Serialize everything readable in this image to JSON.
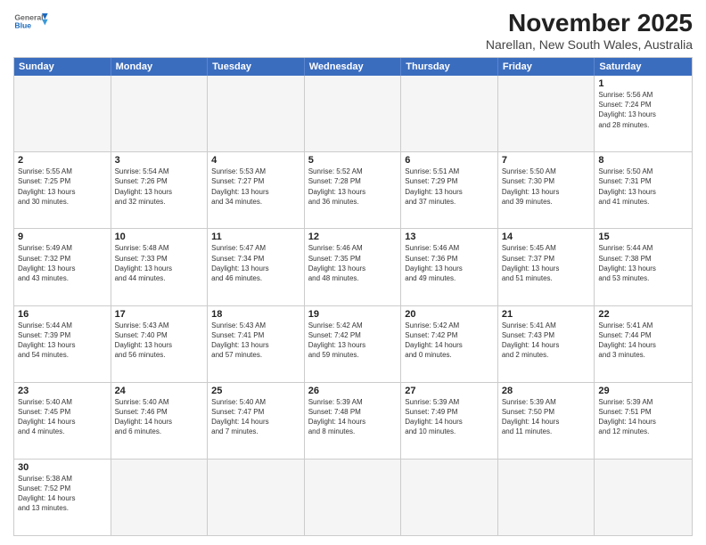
{
  "header": {
    "logo_general": "General",
    "logo_blue": "Blue",
    "month_title": "November 2025",
    "location": "Narellan, New South Wales, Australia"
  },
  "day_headers": [
    "Sunday",
    "Monday",
    "Tuesday",
    "Wednesday",
    "Thursday",
    "Friday",
    "Saturday"
  ],
  "weeks": [
    [
      {
        "num": "",
        "info": ""
      },
      {
        "num": "",
        "info": ""
      },
      {
        "num": "",
        "info": ""
      },
      {
        "num": "",
        "info": ""
      },
      {
        "num": "",
        "info": ""
      },
      {
        "num": "",
        "info": ""
      },
      {
        "num": "1",
        "info": "Sunrise: 5:56 AM\nSunset: 7:24 PM\nDaylight: 13 hours\nand 28 minutes."
      }
    ],
    [
      {
        "num": "2",
        "info": "Sunrise: 5:55 AM\nSunset: 7:25 PM\nDaylight: 13 hours\nand 30 minutes."
      },
      {
        "num": "3",
        "info": "Sunrise: 5:54 AM\nSunset: 7:26 PM\nDaylight: 13 hours\nand 32 minutes."
      },
      {
        "num": "4",
        "info": "Sunrise: 5:53 AM\nSunset: 7:27 PM\nDaylight: 13 hours\nand 34 minutes."
      },
      {
        "num": "5",
        "info": "Sunrise: 5:52 AM\nSunset: 7:28 PM\nDaylight: 13 hours\nand 36 minutes."
      },
      {
        "num": "6",
        "info": "Sunrise: 5:51 AM\nSunset: 7:29 PM\nDaylight: 13 hours\nand 37 minutes."
      },
      {
        "num": "7",
        "info": "Sunrise: 5:50 AM\nSunset: 7:30 PM\nDaylight: 13 hours\nand 39 minutes."
      },
      {
        "num": "8",
        "info": "Sunrise: 5:50 AM\nSunset: 7:31 PM\nDaylight: 13 hours\nand 41 minutes."
      }
    ],
    [
      {
        "num": "9",
        "info": "Sunrise: 5:49 AM\nSunset: 7:32 PM\nDaylight: 13 hours\nand 43 minutes."
      },
      {
        "num": "10",
        "info": "Sunrise: 5:48 AM\nSunset: 7:33 PM\nDaylight: 13 hours\nand 44 minutes."
      },
      {
        "num": "11",
        "info": "Sunrise: 5:47 AM\nSunset: 7:34 PM\nDaylight: 13 hours\nand 46 minutes."
      },
      {
        "num": "12",
        "info": "Sunrise: 5:46 AM\nSunset: 7:35 PM\nDaylight: 13 hours\nand 48 minutes."
      },
      {
        "num": "13",
        "info": "Sunrise: 5:46 AM\nSunset: 7:36 PM\nDaylight: 13 hours\nand 49 minutes."
      },
      {
        "num": "14",
        "info": "Sunrise: 5:45 AM\nSunset: 7:37 PM\nDaylight: 13 hours\nand 51 minutes."
      },
      {
        "num": "15",
        "info": "Sunrise: 5:44 AM\nSunset: 7:38 PM\nDaylight: 13 hours\nand 53 minutes."
      }
    ],
    [
      {
        "num": "16",
        "info": "Sunrise: 5:44 AM\nSunset: 7:39 PM\nDaylight: 13 hours\nand 54 minutes."
      },
      {
        "num": "17",
        "info": "Sunrise: 5:43 AM\nSunset: 7:40 PM\nDaylight: 13 hours\nand 56 minutes."
      },
      {
        "num": "18",
        "info": "Sunrise: 5:43 AM\nSunset: 7:41 PM\nDaylight: 13 hours\nand 57 minutes."
      },
      {
        "num": "19",
        "info": "Sunrise: 5:42 AM\nSunset: 7:42 PM\nDaylight: 13 hours\nand 59 minutes."
      },
      {
        "num": "20",
        "info": "Sunrise: 5:42 AM\nSunset: 7:42 PM\nDaylight: 14 hours\nand 0 minutes."
      },
      {
        "num": "21",
        "info": "Sunrise: 5:41 AM\nSunset: 7:43 PM\nDaylight: 14 hours\nand 2 minutes."
      },
      {
        "num": "22",
        "info": "Sunrise: 5:41 AM\nSunset: 7:44 PM\nDaylight: 14 hours\nand 3 minutes."
      }
    ],
    [
      {
        "num": "23",
        "info": "Sunrise: 5:40 AM\nSunset: 7:45 PM\nDaylight: 14 hours\nand 4 minutes."
      },
      {
        "num": "24",
        "info": "Sunrise: 5:40 AM\nSunset: 7:46 PM\nDaylight: 14 hours\nand 6 minutes."
      },
      {
        "num": "25",
        "info": "Sunrise: 5:40 AM\nSunset: 7:47 PM\nDaylight: 14 hours\nand 7 minutes."
      },
      {
        "num": "26",
        "info": "Sunrise: 5:39 AM\nSunset: 7:48 PM\nDaylight: 14 hours\nand 8 minutes."
      },
      {
        "num": "27",
        "info": "Sunrise: 5:39 AM\nSunset: 7:49 PM\nDaylight: 14 hours\nand 10 minutes."
      },
      {
        "num": "28",
        "info": "Sunrise: 5:39 AM\nSunset: 7:50 PM\nDaylight: 14 hours\nand 11 minutes."
      },
      {
        "num": "29",
        "info": "Sunrise: 5:39 AM\nSunset: 7:51 PM\nDaylight: 14 hours\nand 12 minutes."
      }
    ],
    [
      {
        "num": "30",
        "info": "Sunrise: 5:38 AM\nSunset: 7:52 PM\nDaylight: 14 hours\nand 13 minutes."
      },
      {
        "num": "",
        "info": ""
      },
      {
        "num": "",
        "info": ""
      },
      {
        "num": "",
        "info": ""
      },
      {
        "num": "",
        "info": ""
      },
      {
        "num": "",
        "info": ""
      },
      {
        "num": "",
        "info": ""
      }
    ]
  ]
}
